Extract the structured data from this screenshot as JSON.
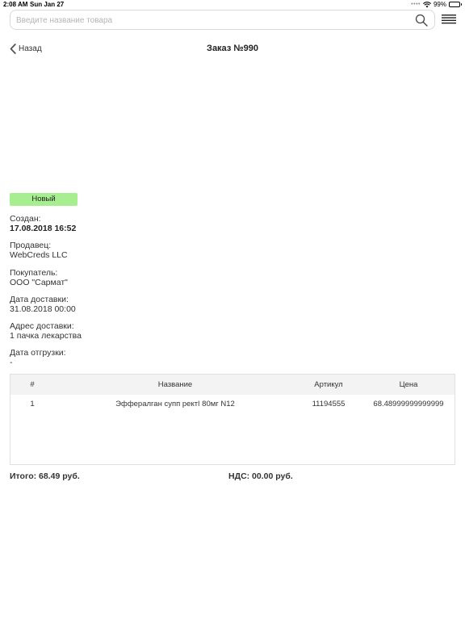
{
  "status_bar": {
    "time": "2:08 AM",
    "date": "Sun Jan 27",
    "battery": "99%"
  },
  "search": {
    "placeholder": "Введите название товара",
    "value": ""
  },
  "nav": {
    "back_label": "Назад",
    "title": "Заказ №990"
  },
  "order": {
    "status": "Новый",
    "status_color": "#a6ee8f",
    "fields": [
      {
        "label": "Создан:",
        "value": "17.08.2018 16:52",
        "bold": true
      },
      {
        "label": "Продавец:",
        "value": "WebCreds LLC",
        "bold": false
      },
      {
        "label": "Покупатель:",
        "value": "ООО \"Сармат\"",
        "bold": false
      },
      {
        "label": "Дата доставки:",
        "value": "31.08.2018 00:00",
        "bold": false
      },
      {
        "label": "Адрес доставки:",
        "value": "1 пачка лекарства",
        "bold": false
      },
      {
        "label": "Дата отгрузки:",
        "value": "-",
        "bold": false
      }
    ]
  },
  "table": {
    "headers": [
      "#",
      "Название",
      "Артикул",
      "Цена"
    ],
    "rows": [
      [
        "1",
        "Эффералган супп ректǀ 80мг N12",
        "11194555",
        "68.48999999999999"
      ]
    ]
  },
  "totals": {
    "total": "Итого: 68.49 руб.",
    "vat": "НДС: 00.00 руб."
  }
}
